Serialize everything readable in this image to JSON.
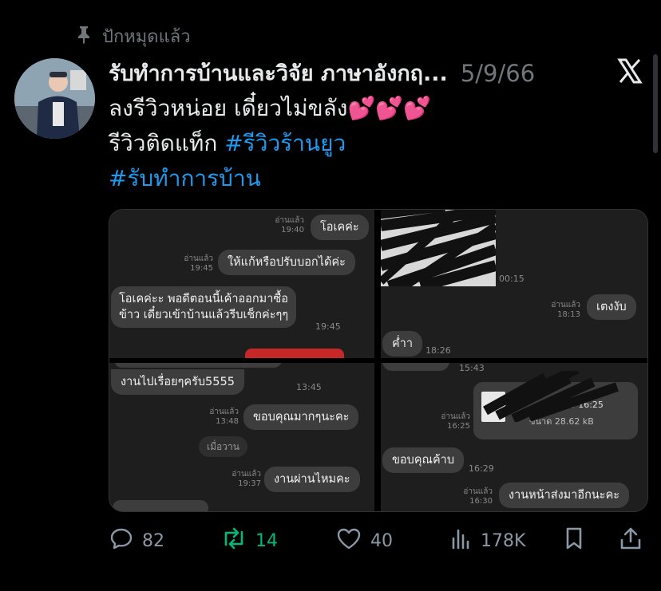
{
  "pinned": {
    "label": "ปักหมุดแล้ว",
    "icon": "pin-icon"
  },
  "tweet": {
    "display_name": "รับทำการบ้านและวิจัย ภาษาอังกฤ...",
    "date": "5/9/66",
    "line1": "ลงรีวิวหน่อย เดี๋ยวไม่ขลัง",
    "line1_emoji": "💕💕💕",
    "line2_prefix": "รีวิวติดแท็ก ",
    "hashtag1": "#รีวิวร้านยูว",
    "hashtag2": "#รับทำการบ้าน"
  },
  "chat_panels": {
    "p1": {
      "read1": "อ่านแล้ว",
      "time1": "19:40",
      "msg1": "โอเคค่ะ",
      "read2": "อ่านแล้ว",
      "time2": "19:45",
      "msg2": "ให้แก้หรือปรับบอกได้ค่ะ",
      "msg3_line1": "โอเคค่ะะ พอดีตอนนี้เค้าออกมาซื้อ",
      "msg3_line2": "ข้าว เดี๋ยวเข้าบ้านแล้วรีบเช็กค่ะๆๆ",
      "time3": "19:45"
    },
    "p2": {
      "time1": "00:15",
      "read1": "อ่านแล้ว",
      "time2": "18:13",
      "msg1": "เตงงับ",
      "msg2": "ค่ำา",
      "time3": "18:26"
    },
    "p3": {
      "msg1": "งานไปเรื่อยๆครับ5555",
      "time1": "13:45",
      "read1": "อ่านแล้ว",
      "time2": "13:48",
      "msg2": "ขอบคุณมากๆนะคะ",
      "day": "เมื่อวาน",
      "read2": "อ่านแล้ว",
      "time3": "19:37",
      "msg3": "งานผ่านไหมคะ"
    },
    "p4": {
      "time1": "15:43",
      "read1": "อ่านแล้ว",
      "time2": "16:25",
      "file_date": "9/9 16:25",
      "file_size": "ขนาด 28.62 kB",
      "msg1": "ขอบคุณค้าบ",
      "time3": "16:29",
      "read2": "อ่านแล้ว",
      "time4": "16:30",
      "msg2": "งานหน้าส่งมาอีกนะคะ"
    }
  },
  "actions": {
    "replies": "82",
    "retweets": "14",
    "likes": "40",
    "views": "178K"
  },
  "colors": {
    "accent": "#1d9bf0",
    "retweet": "#00ba7c",
    "muted": "#71767b"
  }
}
